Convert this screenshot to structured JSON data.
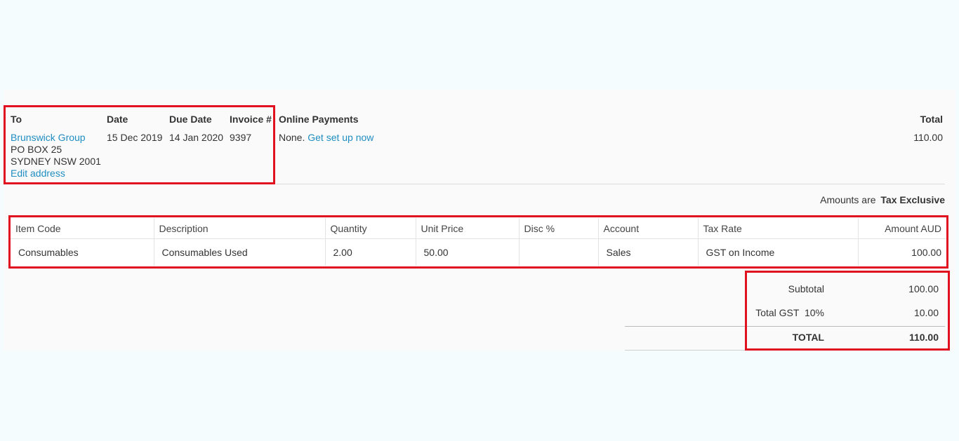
{
  "invoice": {
    "to_label": "To",
    "date_label": "Date",
    "due_date_label": "Due Date",
    "invoice_no_label": "Invoice #",
    "online_payments_label": "Online Payments",
    "total_label": "Total",
    "contact_name": "Brunswick Group",
    "address_line1": "PO BOX 25",
    "address_line2": "SYDNEY NSW 2001",
    "edit_address": "Edit address",
    "date": "15 Dec 2019",
    "due_date": "14 Jan 2020",
    "invoice_no": "9397",
    "online_payments_status": "None.",
    "online_payments_link": "Get set up now",
    "total": "110.00"
  },
  "amounts": {
    "prefix": "Amounts are",
    "mode": "Tax Exclusive"
  },
  "line_items": {
    "columns": [
      "Item Code",
      "Description",
      "Quantity",
      "Unit Price",
      "Disc %",
      "Account",
      "Tax Rate",
      "Amount AUD"
    ],
    "rows": [
      {
        "item_code": "Consumables",
        "description": "Consumables Used",
        "quantity": "2.00",
        "unit_price": "50.00",
        "disc": "",
        "account": "Sales",
        "tax_rate": "GST on Income",
        "amount": "100.00"
      }
    ]
  },
  "totals": {
    "subtotal_label": "Subtotal",
    "subtotal": "100.00",
    "gst_label": "Total GST  10%",
    "gst": "10.00",
    "total_label": "TOTAL",
    "total": "110.00"
  },
  "colors": {
    "link": "#1f8dc2",
    "highlight": "#e0121f",
    "background": "#f5fcfd"
  }
}
